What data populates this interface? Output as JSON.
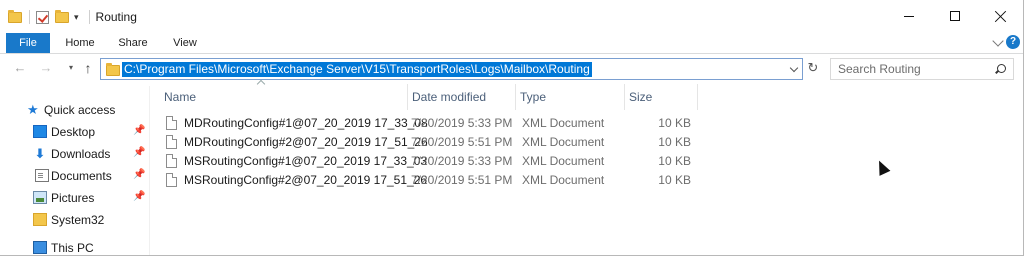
{
  "window": {
    "title": "Routing",
    "qat_arrow": "▾",
    "controls": {
      "minimize": "minimize",
      "maximize": "maximize",
      "close": "close"
    }
  },
  "ribbon": {
    "tabs": [
      {
        "label": "File"
      },
      {
        "label": "Home"
      },
      {
        "label": "Share"
      },
      {
        "label": "View"
      }
    ],
    "help": "?"
  },
  "address": {
    "path": "C:\\Program Files\\Microsoft\\Exchange Server\\V15\\TransportRoles\\Logs\\Mailbox\\Routing",
    "back": "←",
    "forward": "→",
    "recent": "▾",
    "up": "↑",
    "refresh": "↻"
  },
  "search": {
    "placeholder": "Search Routing"
  },
  "nav_pane": {
    "items": [
      {
        "label": "Quick access"
      },
      {
        "label": "Desktop"
      },
      {
        "label": "Downloads"
      },
      {
        "label": "Documents"
      },
      {
        "label": "Pictures"
      },
      {
        "label": "System32"
      },
      {
        "label": "This PC"
      }
    ],
    "pin_glyph": "📌",
    "star_glyph": "★",
    "download_glyph": "⬇"
  },
  "columns": [
    "Name",
    "Date modified",
    "Type",
    "Size"
  ],
  "files": [
    {
      "name": "MDRoutingConfig#1@07_20_2019 17_33_08",
      "date": "7/20/2019 5:33 PM",
      "type": "XML Document",
      "size": "10 KB"
    },
    {
      "name": "MDRoutingConfig#2@07_20_2019 17_51_26",
      "date": "7/20/2019 5:51 PM",
      "type": "XML Document",
      "size": "10 KB"
    },
    {
      "name": "MSRoutingConfig#1@07_20_2019 17_33_03",
      "date": "7/20/2019 5:33 PM",
      "type": "XML Document",
      "size": "10 KB"
    },
    {
      "name": "MSRoutingConfig#2@07_20_2019 17_51_26",
      "date": "7/20/2019 5:51 PM",
      "type": "XML Document",
      "size": "10 KB"
    }
  ],
  "colors": {
    "accent": "#1979ca",
    "selection": "#0078d7",
    "header_text": "#4c607a"
  }
}
